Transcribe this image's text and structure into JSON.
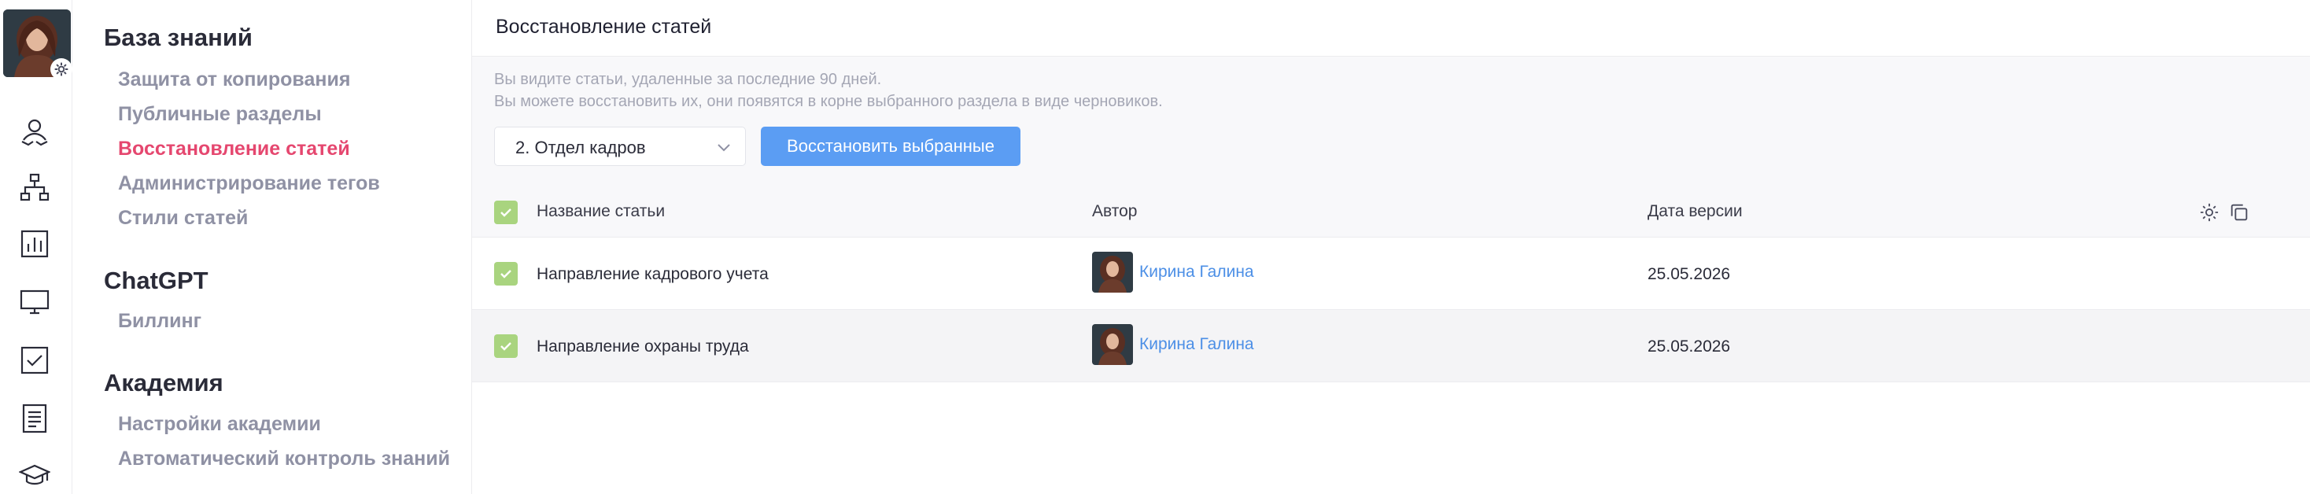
{
  "sidebar": {
    "sections": [
      {
        "title": "База знаний",
        "items": [
          {
            "label": "Защита от копирования"
          },
          {
            "label": "Публичные разделы"
          },
          {
            "label": "Восстановление статей"
          },
          {
            "label": "Администрирование тегов"
          },
          {
            "label": "Стили статей"
          }
        ]
      },
      {
        "title": "ChatGPT",
        "items": [
          {
            "label": "Биллинг"
          }
        ]
      },
      {
        "title": "Академия",
        "items": [
          {
            "label": "Настройки академии"
          },
          {
            "label": "Автоматический контроль знаний"
          }
        ]
      }
    ]
  },
  "rail": {
    "icons": [
      "user-hands-icon",
      "hierarchy-icon",
      "bar-chart-icon",
      "monitor-icon",
      "checkbox-icon",
      "document-icon",
      "graduation-cap-icon"
    ]
  },
  "main": {
    "title": "Восстановление статей",
    "info_line_1": "Вы видите статьи, удаленные за последние 90 дней.",
    "info_line_2": "Вы можете восстановить их, они появятся в корне выбранного раздела в виде черновиков.",
    "section_select": {
      "value": "2. Отдел кадров"
    },
    "restore_button": "Восстановить выбранные"
  },
  "table": {
    "headers": {
      "name": "Название статьи",
      "author": "Автор",
      "date": "Дата версии"
    },
    "rows": [
      {
        "name": "Направление кадрового учета",
        "author": "Кирина Галина",
        "date": "25.05.2026",
        "checked": true
      },
      {
        "name": "Направление охраны труда",
        "author": "Кирина Галина",
        "date": "25.05.2026",
        "checked": true
      }
    ]
  },
  "colors": {
    "accent_active": "#e5476f",
    "primary_button": "#5b9df3",
    "checkbox_green": "#a9d47f",
    "author_link": "#4c8fe6"
  }
}
